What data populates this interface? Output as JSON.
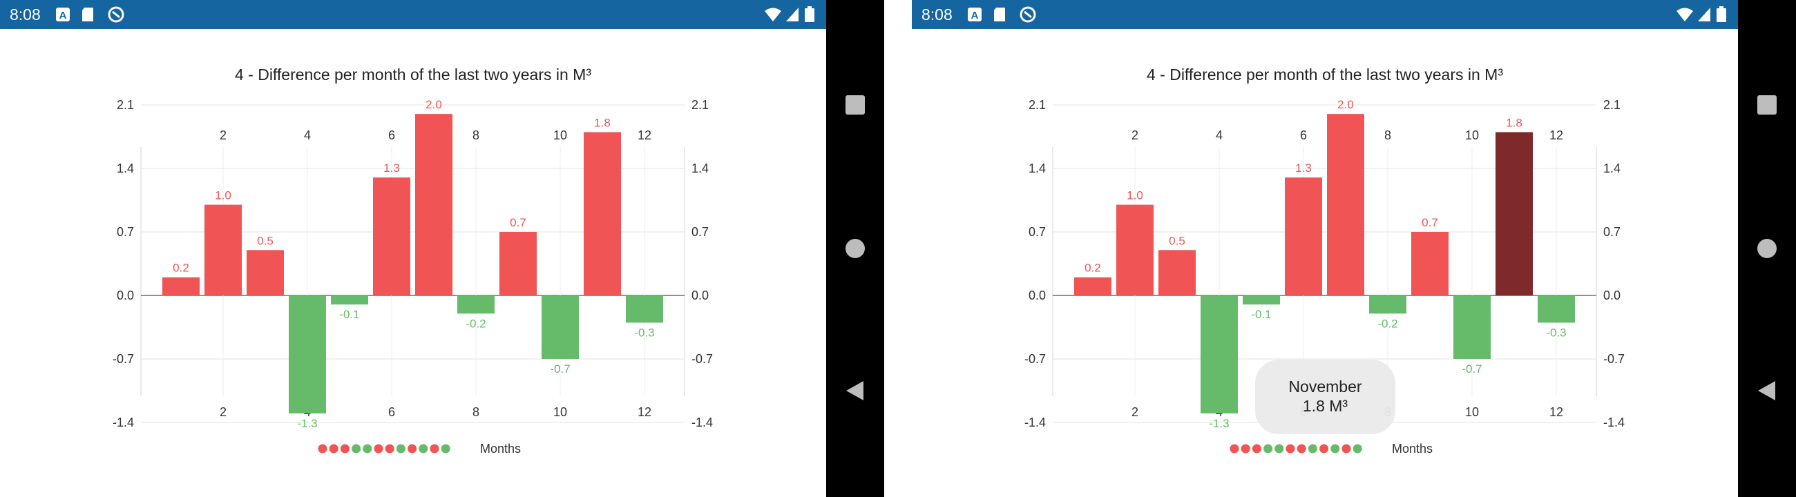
{
  "status_bar": {
    "time": "8:08",
    "color": "#1565a0"
  },
  "chart": {
    "title": "4 - Difference per month of the last two years in M³",
    "legend_label": "Months",
    "colors": {
      "positive": "#f05454",
      "negative": "#66bb6a",
      "selected": "#7f2a2a"
    }
  },
  "chart_data": {
    "type": "bar",
    "title": "4 - Difference per month of the last two years in M³",
    "x": [
      1,
      2,
      3,
      4,
      5,
      6,
      7,
      8,
      9,
      10,
      11,
      12
    ],
    "values": [
      0.2,
      1.0,
      0.5,
      -1.3,
      -0.1,
      1.3,
      2.0,
      -0.2,
      0.7,
      -0.7,
      1.8,
      -0.3
    ],
    "data_labels": [
      "0.2",
      "1.0",
      "0.5",
      "-1.3",
      "-0.1",
      "1.3",
      "2.0",
      "-0.2",
      "0.7",
      "-0.7",
      "1.8",
      "-0.3"
    ],
    "x_ticks": [
      "2",
      "4",
      "6",
      "8",
      "10",
      "12"
    ],
    "y_ticks": [
      "2.1",
      "1.4",
      "0.7",
      "0.0",
      "-0.7",
      "-1.4"
    ],
    "ylim": [
      -1.4,
      2.1
    ],
    "xlim": [
      0.5,
      12.5
    ],
    "grid": true,
    "legend": "bottom",
    "series_name": "Months"
  },
  "tooltip": {
    "title": "November",
    "value": "1.8 M³",
    "selected_index": 10
  },
  "navbar": {
    "icons": [
      "recents-icon",
      "home-icon",
      "back-icon"
    ]
  }
}
